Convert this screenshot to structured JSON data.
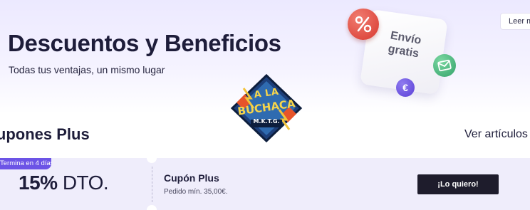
{
  "banner": {
    "title": "Descuentos y Beneficios",
    "subtitle": "Todas tus ventajas, un mismo lugar",
    "read_more_label": "Leer más",
    "illustration": {
      "card_line1": "Envío",
      "card_line2": "gratis",
      "percent_symbol": "%",
      "euro_symbol": "€",
      "icons": [
        "percent-icon",
        "mail-icon",
        "euro-icon"
      ]
    }
  },
  "logo": {
    "line1": "A LA",
    "line2": "BUCHACA",
    "line3": "M.K.T.G."
  },
  "section": {
    "title": "Cupones Plus",
    "see_all_label": "Ver artículos"
  },
  "coupon": {
    "expiry_badge": "Termina en 4 días",
    "discount_value": "15%",
    "discount_suffix": " DTO.",
    "name": "Cupón Plus",
    "min_order": "Pedido mín. 35,00€.",
    "cta_label": "¡Lo quiero!"
  },
  "colors": {
    "accent": "#6c54e6",
    "banner_bg": "#ece9ff",
    "coupon_bg": "#efedfb",
    "cta_bg": "#1e1c2c",
    "text": "#1e1d3a"
  }
}
